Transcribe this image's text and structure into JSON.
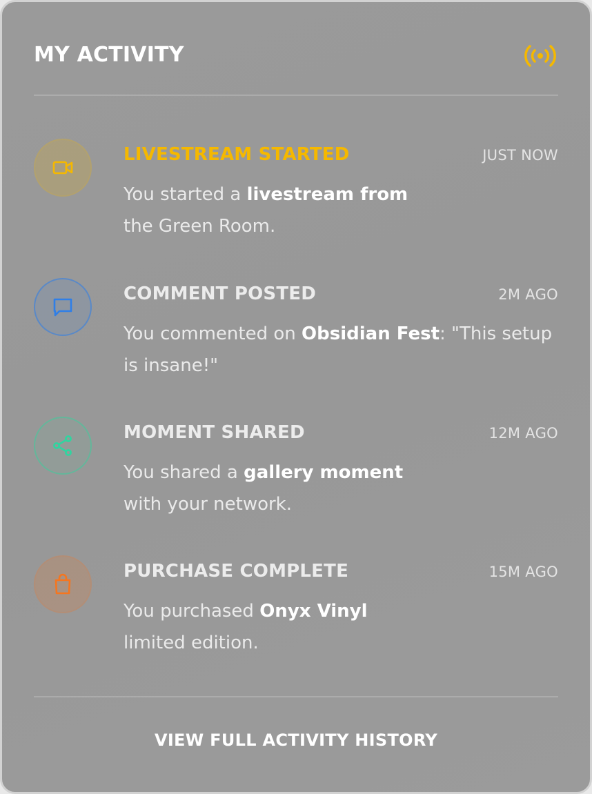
{
  "header": {
    "title": "MY ACTIVITY",
    "icon": "live-broadcast-icon",
    "icon_color": "#f5b800"
  },
  "items": [
    {
      "icon": "video-camera-icon",
      "color": "#f5b800",
      "title": "LIVESTREAM STARTED",
      "time": "JUST NOW",
      "desc_pre": "You started a ",
      "desc_bold": "livestream from",
      "desc_post": " the Green Room."
    },
    {
      "icon": "chat-bubble-icon",
      "color": "#2f7fe8",
      "title": "COMMENT POSTED",
      "time": "2M AGO",
      "desc_pre": "You commented on ",
      "desc_bold": "Obsidian Fest",
      "desc_post": ": \"This setup is insane!\""
    },
    {
      "icon": "share-icon",
      "color": "#2ed6a0",
      "title": "MOMENT SHARED",
      "time": "12M AGO",
      "desc_pre": "You shared a ",
      "desc_bold": "gallery moment",
      "desc_post": " with your network."
    },
    {
      "icon": "shopping-bag-icon",
      "color": "#f5761f",
      "title": "PURCHASE COMPLETE",
      "time": "15M AGO",
      "desc_pre": "You purchased ",
      "desc_bold": "Onyx Vinyl",
      "desc_post": " limited edition."
    }
  ],
  "footer": {
    "link_label": "VIEW FULL ACTIVITY HISTORY"
  }
}
